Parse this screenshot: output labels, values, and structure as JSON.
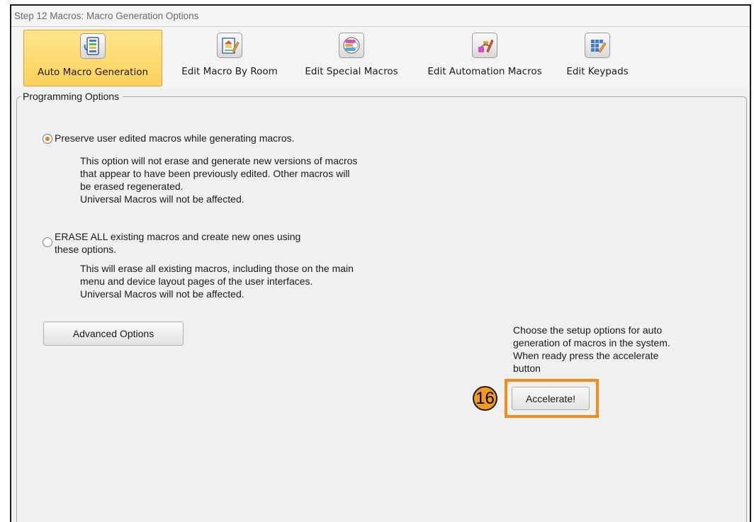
{
  "window": {
    "title": "Step 12 Macros: Macro Generation Options"
  },
  "toolbar": {
    "items": [
      {
        "label": "Auto Macro Generation",
        "icon": "auto-macro-icon",
        "active": true
      },
      {
        "label": "Edit Macro By Room",
        "icon": "edit-room-icon",
        "active": false
      },
      {
        "label": "Edit Special Macros",
        "icon": "special-macros-icon",
        "active": false
      },
      {
        "label": "Edit Automation Macros",
        "icon": "automation-macros-icon",
        "active": false
      },
      {
        "label": "Edit Keypads",
        "icon": "keypads-icon",
        "active": false
      }
    ]
  },
  "programming": {
    "legend": "Programming Options",
    "option1": {
      "label": "Preserve user edited macros while generating macros.",
      "checked": true,
      "description": [
        "This option will not erase and generate new versions of macros",
        "that appear to have been previously edited. Other macros will",
        "be erased regenerated.",
        "Universal Macros will not be affected."
      ]
    },
    "option2": {
      "label_line1": "ERASE ALL existing macros and create new ones using",
      "label_line2": "these options.",
      "checked": false,
      "description": [
        "This will erase all existing macros, including those on the main",
        "menu and device layout pages of the user interfaces.",
        "Universal Macros will not be affected."
      ]
    },
    "advanced_button": "Advanced Options",
    "hint": [
      "Choose the setup options for auto",
      "generation of macros in the system.",
      "When ready press the accelerate",
      "button"
    ],
    "accelerate_button": "Accelerate!"
  },
  "callout": {
    "number": "16",
    "color": "#f28c1e"
  }
}
